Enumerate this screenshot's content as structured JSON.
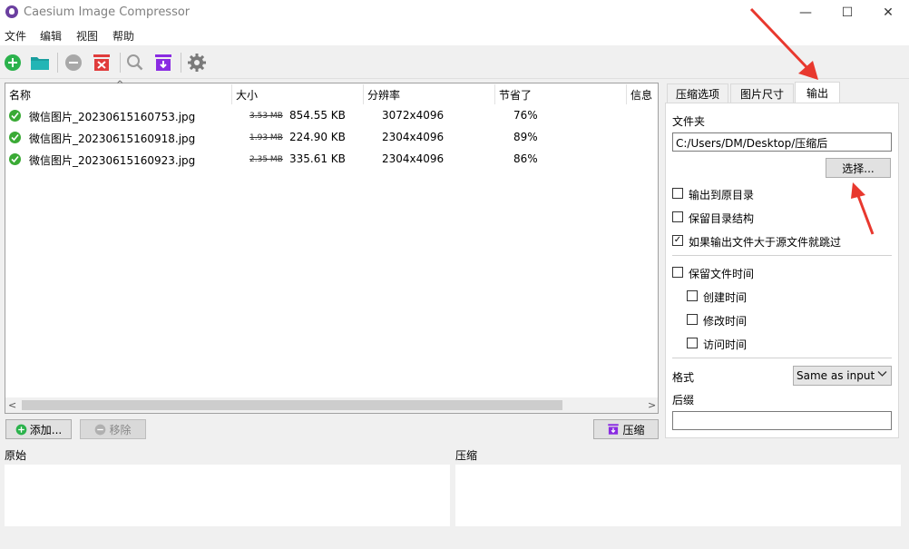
{
  "window": {
    "title": "Caesium Image Compressor",
    "minimize_glyph": "—",
    "maximize_glyph": "☐",
    "close_glyph": "✕"
  },
  "menu": [
    "文件",
    "编辑",
    "视图",
    "帮助"
  ],
  "toolbar": {
    "icons": [
      "add-icon",
      "folder-icon",
      "remove-icon",
      "clear-list-icon",
      "search-icon",
      "compress-icon",
      "settings-icon"
    ]
  },
  "file_list": {
    "columns": [
      "名称",
      "大小",
      "分辨率",
      "节省了",
      "信息"
    ],
    "rows": [
      {
        "name": "微信图片_20230615160753.jpg",
        "orig_size": "3.53 MB",
        "new_size": "854.55 KB",
        "resolution": "3072x4096",
        "saved": "76%"
      },
      {
        "name": "微信图片_20230615160918.jpg",
        "orig_size": "1.93 MB",
        "new_size": "224.90 KB",
        "resolution": "2304x4096",
        "saved": "89%"
      },
      {
        "name": "微信图片_20230615160923.jpg",
        "orig_size": "2.35 MB",
        "new_size": "335.61 KB",
        "resolution": "2304x4096",
        "saved": "86%"
      }
    ]
  },
  "buttons": {
    "add": "添加...",
    "remove": "移除",
    "compress": "压缩"
  },
  "preview": {
    "original_label": "原始",
    "compressed_label": "压缩"
  },
  "tabs": [
    "压缩选项",
    "图片尺寸",
    "输出"
  ],
  "output": {
    "folder_label": "文件夹",
    "folder_value": "C:/Users/DM/Desktop/压缩后",
    "choose_button": "选择...",
    "options": [
      {
        "label": "输出到原目录",
        "checked": false
      },
      {
        "label": "保留目录结构",
        "checked": false
      },
      {
        "label": "如果输出文件大于源文件就跳过",
        "checked": true
      }
    ],
    "keep_dates": {
      "label": "保留文件时间",
      "checked": false
    },
    "date_options": [
      {
        "label": "创建时间",
        "checked": false
      },
      {
        "label": "修改时间",
        "checked": false
      },
      {
        "label": "访问时间",
        "checked": false
      }
    ],
    "format_label": "格式",
    "format_value": "Same as input",
    "suffix_label": "后缀",
    "suffix_value": ""
  },
  "colors": {
    "accent_purple": "#8a2be2",
    "add_green": "#2bb24c",
    "folder_teal": "#1a9e9e",
    "remove_red": "#e03c3c",
    "success_green": "#3aaa35",
    "annotation_red": "#e8382e"
  }
}
